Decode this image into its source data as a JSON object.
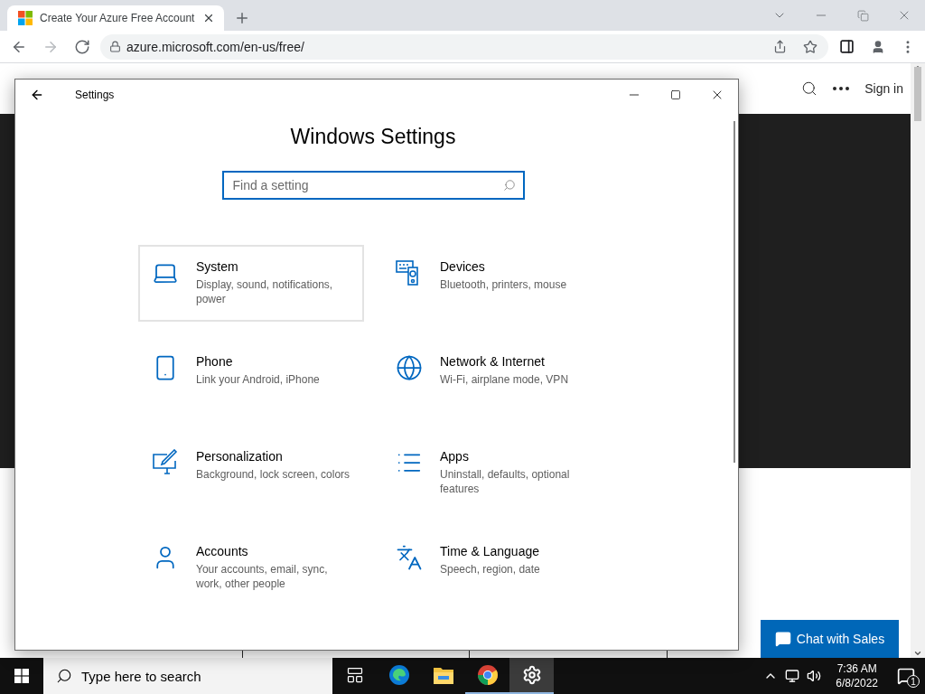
{
  "browser": {
    "tab": {
      "title": "Create Your Azure Free Account"
    },
    "nav": [
      {
        "kind": "back",
        "disabled": false
      },
      {
        "kind": "forward",
        "disabled": true
      },
      {
        "kind": "reload",
        "disabled": false
      }
    ],
    "url": "azure.microsoft.com/en-us/free/"
  },
  "page": {
    "sign_in": "Sign in",
    "chat": "Chat with Sales"
  },
  "settings": {
    "title": "Settings",
    "heading": "Windows Settings",
    "search": {
      "placeholder": "Find a setting"
    },
    "categories": [
      {
        "kind": "system",
        "title": "System",
        "description": "Display, sound, notifications, power",
        "selected": true
      },
      {
        "kind": "devices",
        "title": "Devices",
        "description": "Bluetooth, printers, mouse",
        "selected": false
      },
      {
        "kind": "phone",
        "title": "Phone",
        "description": "Link your Android, iPhone",
        "selected": false
      },
      {
        "kind": "network",
        "title": "Network & Internet",
        "description": "Wi-Fi, airplane mode, VPN",
        "selected": false
      },
      {
        "kind": "personalization",
        "title": "Personalization",
        "description": "Background, lock screen, colors",
        "selected": false
      },
      {
        "kind": "apps",
        "title": "Apps",
        "description": "Uninstall, defaults, optional features",
        "selected": false
      },
      {
        "kind": "accounts",
        "title": "Accounts",
        "description": "Your accounts, email, sync, work, other people",
        "selected": false
      },
      {
        "kind": "time",
        "title": "Time & Language",
        "description": "Speech, region, date",
        "selected": false
      }
    ]
  },
  "taskbar": {
    "search": {
      "placeholder": "Type here to search"
    },
    "apps": [
      {
        "kind": "taskview",
        "running": false,
        "active": false
      },
      {
        "kind": "edge",
        "running": false,
        "active": false
      },
      {
        "kind": "explorer",
        "running": false,
        "active": false
      },
      {
        "kind": "chrome",
        "running": true,
        "active": false
      },
      {
        "kind": "settings",
        "running": true,
        "active": true
      }
    ],
    "time": "7:36 AM",
    "date": "6/8/2022",
    "notifications": "1"
  }
}
